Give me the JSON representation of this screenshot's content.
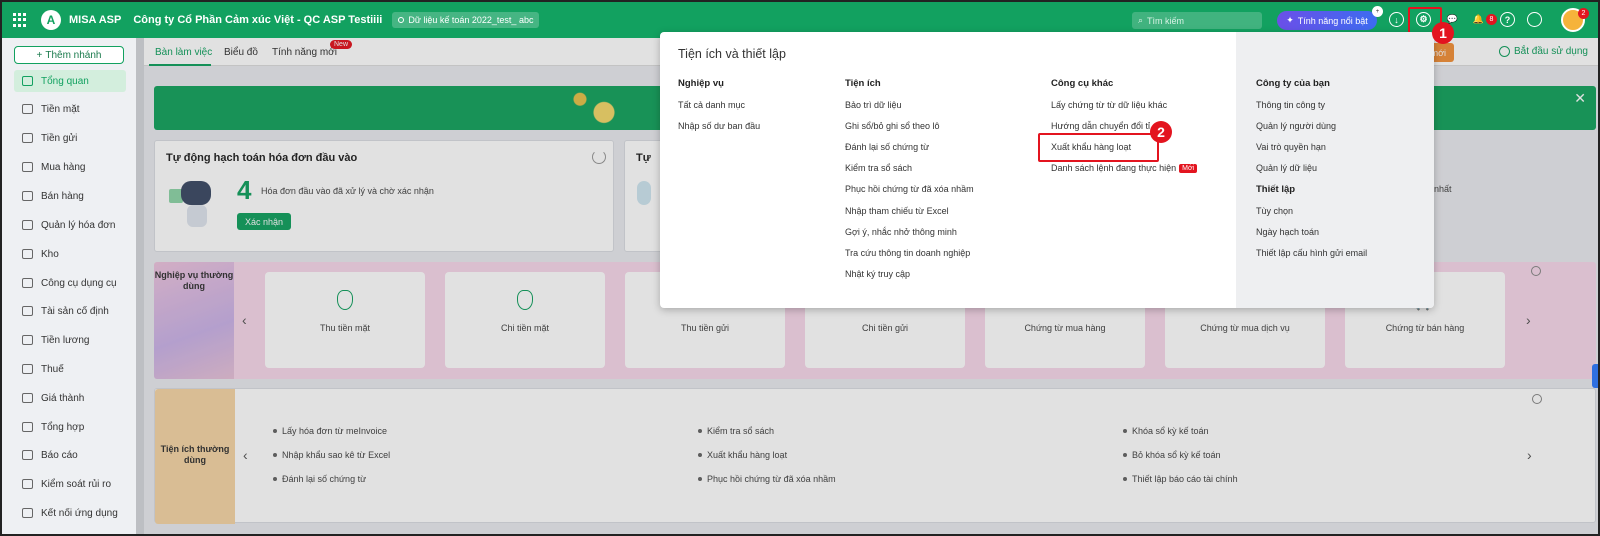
{
  "topbar": {
    "app_name": "MISA ASP",
    "logo_letter": "A",
    "company": "Công ty Cổ Phần Cảm xúc Việt - QC ASP Testiiii",
    "database": "Dữ liệu kế toán 2022_test_ abc",
    "search_placeholder": "Tìm kiếm",
    "feature_button": "Tính năng nổi bật",
    "feature_badge": "+",
    "notification_count": "8",
    "avatar_badge": "2",
    "brand_color": "#12a160"
  },
  "annotations": {
    "step1": "1",
    "step2": "2"
  },
  "sidebar": {
    "add_branch": "Thêm nhánh",
    "items": [
      {
        "label": "Tổng quan",
        "icon": "dashboard-icon"
      },
      {
        "label": "Tiền mặt",
        "icon": "cash-icon"
      },
      {
        "label": "Tiền gửi",
        "icon": "bank-icon"
      },
      {
        "label": "Mua hàng",
        "icon": "shopping-bag-icon"
      },
      {
        "label": "Bán hàng",
        "icon": "cart-icon"
      },
      {
        "label": "Quản lý hóa đơn",
        "icon": "invoice-icon"
      },
      {
        "label": "Kho",
        "icon": "warehouse-icon"
      },
      {
        "label": "Công cụ dụng cụ",
        "icon": "tools-icon"
      },
      {
        "label": "Tài sản cố định",
        "icon": "asset-icon"
      },
      {
        "label": "Tiền lương",
        "icon": "salary-icon"
      },
      {
        "label": "Thuế",
        "icon": "tax-icon"
      },
      {
        "label": "Giá thành",
        "icon": "cost-icon"
      },
      {
        "label": "Tổng hợp",
        "icon": "summary-icon"
      },
      {
        "label": "Báo cáo",
        "icon": "report-icon"
      },
      {
        "label": "Kiểm soát rủi ro",
        "icon": "risk-icon"
      },
      {
        "label": "Kết nối ứng dụng",
        "icon": "link-icon"
      }
    ]
  },
  "main": {
    "tabs": [
      {
        "label": "Bàn làm việc"
      },
      {
        "label": "Biểu đồ"
      },
      {
        "label": "Tính năng mới"
      }
    ],
    "tab_new_badge": "New",
    "orange_button": "diện mới",
    "start_use": "Bắt đầu sử dụng",
    "card1": {
      "title": "Tự động hạch toán hóa đơn đầu vào",
      "count": "4",
      "desc": "Hóa đơn đầu vào đã xử lý và chờ xác nhận",
      "button": "Xác nhận"
    },
    "card2": {
      "title": "Tự",
      "desc_tail": "nhất"
    },
    "nghiep_vu": {
      "label": "Nghiệp vụ thường dùng",
      "tiles": [
        "Thu tiền mặt",
        "Chi tiền mặt",
        "Thu tiền gửi",
        "Chi tiền gửi",
        "Chứng từ mua hàng",
        "Chứng từ mua dịch vụ",
        "Chứng từ bán hàng"
      ]
    },
    "tien_ich": {
      "label": "Tiện ích thường dùng",
      "col1": [
        "Lấy hóa đơn từ meInvoice",
        "Nhập khẩu sao kê từ Excel",
        "Đánh lại số chứng từ"
      ],
      "col2": [
        "Kiểm tra sổ sách",
        "Xuất khẩu hàng loạt",
        "Phục hồi chứng từ đã xóa nhầm"
      ],
      "col3": [
        "Khóa sổ kỳ kế toán",
        "Bỏ khóa sổ kỳ kế toán",
        "Thiết lập báo cáo tài chính"
      ]
    }
  },
  "popup": {
    "title": "Tiện ích và thiết lập",
    "columns": [
      {
        "heading": "Nghiệp vụ",
        "items": [
          "Tất cả danh mục",
          "Nhập số dư ban đầu"
        ]
      },
      {
        "heading": "Tiện ích",
        "items": [
          "Bảo trì dữ liệu",
          "Ghi sổ/bỏ ghi sổ theo lô",
          "Đánh lại số chứng từ",
          "Kiểm tra sổ sách",
          "Phục hồi chứng từ đã xóa nhầm",
          "Nhập tham chiếu từ Excel",
          "Gợi ý, nhắc nhở thông minh",
          "Tra cứu thông tin doanh nghiệp",
          "Nhật ký truy cập"
        ]
      },
      {
        "heading": "Công cụ khác",
        "items": [
          "Lấy chứng từ từ dữ liệu khác",
          "Hướng dẫn chuyển đổi tỉ",
          "Xuất khẩu hàng loạt",
          "Danh sách lệnh đang thực hiện"
        ],
        "new_badge": "Mới"
      },
      {
        "heading": "Công ty của bạn",
        "items": [
          "Thông tin công ty",
          "Quản lý người dùng",
          "Vai trò quyền hạn",
          "Quản lý dữ liệu"
        ]
      },
      {
        "heading": "Thiết lập",
        "items": [
          "Tùy chọn",
          "Ngày hạch toán",
          "Thiết lập cấu hình gửi email"
        ]
      }
    ]
  }
}
